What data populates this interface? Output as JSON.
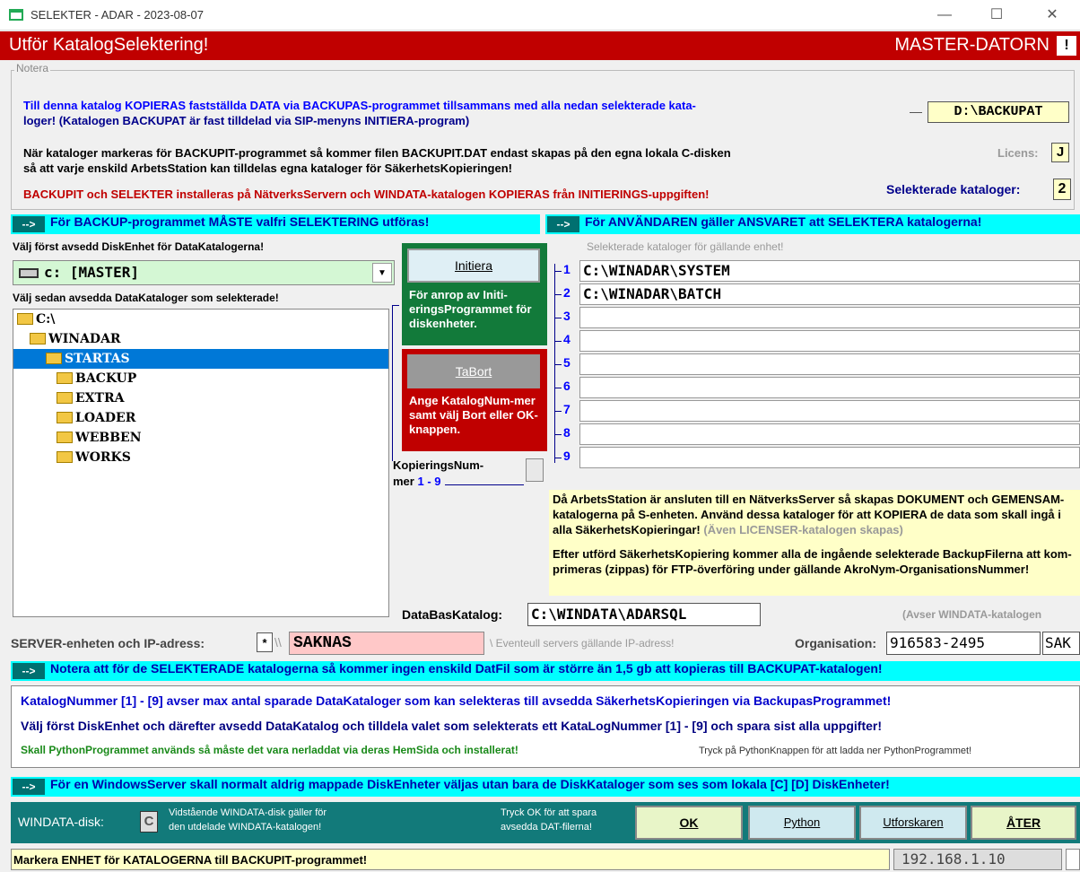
{
  "window": {
    "title": "SELEKTER - ADAR - 2023-08-07",
    "minimize": "—",
    "maximize": "☐",
    "close": "✕"
  },
  "header": {
    "title": "Utför KatalogSelektering!",
    "machine": "MASTER-DATORN",
    "alert": "!"
  },
  "notera": {
    "legend": "Notera",
    "line1": "Till denna katalog KOPIERAS fastställda DATA via BACKUPAS-programmet tillsammans med alla nedan selekterade kata-",
    "line2": "loger! (Katalogen BACKUPAT är fast tilldelad via SIP-menyns INITIERA-program)",
    "backup_path": "D:\\BACKUPAT",
    "line3": "När kataloger markeras för BACKUPIT-programmet så kommer filen BACKUPIT.DAT endast skapas på den egna lokala C-disken",
    "line4": "så att varje enskild ArbetsStation kan tilldelas egna kataloger för SäkerhetsKopieringen!",
    "licens_label": "Licens:",
    "licens_value": "J",
    "line5": "BACKUPIT och SELEKTER installeras på NätverksServern och WINDATA-katalogen KOPIERAS från INITIERINGS-uppgiften!",
    "selected_label": "Selekterade kataloger:",
    "selected_value": "2"
  },
  "bars": {
    "left": "För BACKUP-programmet MÅSTE valfri SELEKTERING utföras!",
    "right": "För ANVÄNDAREN gäller ANSVARET att SELEKTERA katalogerna!",
    "arrow": "-->",
    "notera2": "Notera att för de SELEKTERADE katalogerna så kommer ingen enskild DatFil som är större än 1,5 gb att kopieras till BACKUPAT-katalogen!",
    "windows": "För en WindowsServer skall normalt aldrig mappade DiskEnheter väljas utan bara de DiskKataloger som ses som lokala [C] [D] DiskEnheter!"
  },
  "left": {
    "drive_label": "Välj först avsedd DiskEnhet för DataKatalogerna!",
    "drive_value": "c:  [MASTER]",
    "dir_label": "Välj sedan avsedda DataKataloger som selekterade!",
    "tree": [
      {
        "name": "C:\\",
        "level": 0
      },
      {
        "name": "WINADAR",
        "level": 1
      },
      {
        "name": "STARTAS",
        "level": 2
      },
      {
        "name": "BACKUP",
        "level": 3
      },
      {
        "name": "EXTRA",
        "level": 3
      },
      {
        "name": "LOADER",
        "level": 3
      },
      {
        "name": "WEBBEN",
        "level": 3
      },
      {
        "name": "WORKS",
        "level": 3
      }
    ]
  },
  "middle": {
    "initiera": "Initiera",
    "initiera_desc": "För anrop av Initi-eringsProgrammet för diskenheter.",
    "tabort": "TaBort",
    "tabort_desc": "Ange KatalogNum-mer samt välj Bort eller OK-knappen.",
    "kop_label": "KopieringsNum-",
    "kop_label2": "mer",
    "kop_range": "1 - 9"
  },
  "right": {
    "label": "Selekterade kataloger för gällande enhet!",
    "rows": [
      {
        "n": "1",
        "path": "C:\\WINADAR\\SYSTEM"
      },
      {
        "n": "2",
        "path": "C:\\WINADAR\\BATCH"
      },
      {
        "n": "3",
        "path": ""
      },
      {
        "n": "4",
        "path": ""
      },
      {
        "n": "5",
        "path": ""
      },
      {
        "n": "6",
        "path": ""
      },
      {
        "n": "7",
        "path": ""
      },
      {
        "n": "8",
        "path": ""
      },
      {
        "n": "9",
        "path": ""
      }
    ],
    "info1": "Då ArbetsStation är ansluten till en NätverksServer så skapas DOKUMENT och GEMENSAM-",
    "info2": "katalogerna på S-enheten. Använd dessa kataloger för att KOPIERA de data som skall ingå i",
    "info3": "alla SäkerhetsKopieringar!",
    "info3b": "(Även LICENSER-katalogen skapas)",
    "info4": "Efter utförd SäkerhetsKopiering kommer alla de ingående selekterade BackupFilerna att kom-",
    "info5": "primeras (zippas) för FTP-överföring under gällande AkroNym-OrganisationsNummer!",
    "db_label": "DataBasKatalog:",
    "db_value": "C:\\WINDATA\\ADARSQL",
    "db_note": "(Avser WINDATA-katalogen"
  },
  "server": {
    "label": "SERVER-enheten och IP-adress:",
    "star": "*",
    "slashes": "\\\\",
    "value": "SAKNAS",
    "hint": "Eventeull servers gällande IP-adress!",
    "org_label": "Organisation:",
    "org_value": "916583-2495",
    "org_extra": "SAK"
  },
  "info": {
    "l1": "KatalogNummer [1] - [9] avser max antal sparade DataKataloger som kan selekteras till avsedda SäkerhetsKopieringen via BackupasProgrammet!",
    "l2": "Välj först DiskEnhet och därefter avsedd DataKatalog och tilldela valet som selekterats ett KataLogNummer [1] - [9] och spara sist alla uppgifter!",
    "l3": "Skall PythonProgrammet används så måste det vara nerladdat via deras HemSida och installerat!",
    "l3r": "Tryck på PythonKnappen för att ladda ner PythonProgrammet!"
  },
  "bottom": {
    "windata_label": "WINDATA-disk:",
    "windata_value": "C",
    "desc1": "Vidstående WINDATA-disk gäller för",
    "desc2": "den utdelade WINDATA-katalogen!",
    "tip1": "Tryck OK för att spara",
    "tip2": "avsedda DAT-filerna!",
    "ok": "OK",
    "python": "Python",
    "explorer": "Utforskaren",
    "back": "ÅTER"
  },
  "status": {
    "text": "Markera ENHET för KATALOGERNA till BACKUPIT-programmet!",
    "ip": "192.168.1.10"
  }
}
